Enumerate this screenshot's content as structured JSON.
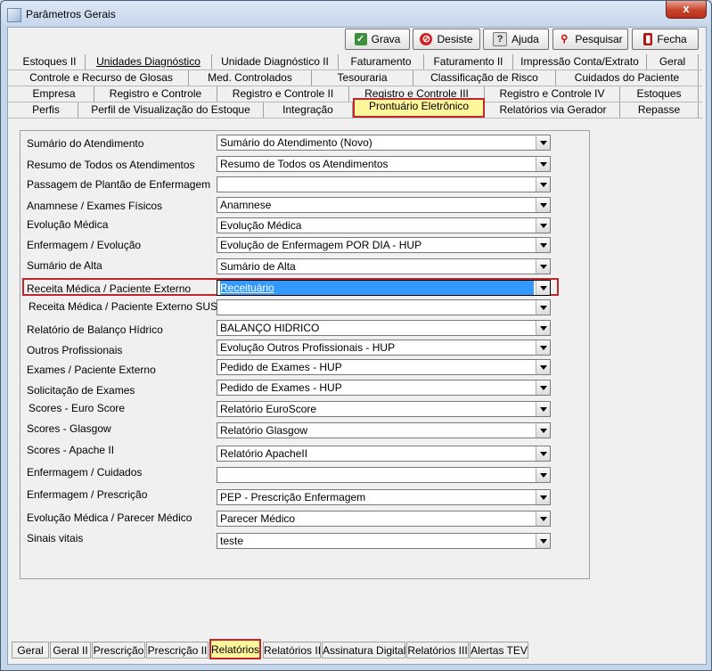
{
  "window": {
    "title": "Parâmetros Gerais",
    "close_glyph": "x"
  },
  "toolbar": {
    "grava": "Grava",
    "desiste": "Desiste",
    "ajuda": "Ajuda",
    "pesquisar": "Pesquisar",
    "fecha": "Fecha"
  },
  "top_tabs": {
    "row1": [
      "Estoques II",
      "Unidades Diagnóstico",
      "Unidade Diagnóstico II",
      "Faturamento",
      "Faturamento II",
      "Impressão Conta/Extrato",
      "Geral"
    ],
    "row2": [
      "Controle e Recurso de Glosas",
      "Med. Controlados",
      "Tesouraria",
      "Classificação de Risco",
      "Cuidados do Paciente"
    ],
    "row3": [
      "Empresa",
      "Registro e Controle",
      "Registro e Controle II",
      "Registro e Controle III",
      "Registro e Controle IV",
      "Estoques"
    ],
    "row4": [
      "Perfis",
      "Perfil de Visualização do Estoque",
      "Integração",
      "Prontuário Eletrônico",
      "Relatórios via Gerador",
      "Repasse"
    ],
    "selected": "Prontuário Eletrônico"
  },
  "fields": [
    {
      "label": "Sumário do Atendimento",
      "value": "Sumário do Atendimento (Novo)"
    },
    {
      "label": "Resumo de Todos os Atendimentos",
      "value": "Resumo de Todos os Atendimentos"
    },
    {
      "label": "Passagem de Plantão de Enfermagem",
      "value": ""
    },
    {
      "label": "Anamnese / Exames Físicos",
      "value": "Anamnese"
    },
    {
      "label": "Evolução Médica",
      "value": "Evolução Médica"
    },
    {
      "label": "Enfermagem / Evolução",
      "value": "Evolução de Enfermagem POR DIA - HUP"
    },
    {
      "label": "Sumário de Alta",
      "value": "Sumário de Alta"
    },
    {
      "label": "Receita Médica / Paciente Externo",
      "value": "Receituário"
    },
    {
      "label": "Receita Médica / Paciente Externo SUS",
      "value": ""
    },
    {
      "label": "Relatório de Balanço Hídrico",
      "value": "BALANÇO HIDRICO"
    },
    {
      "label": "Outros Profissionais",
      "value": "Evolução Outros Profissionais - HUP"
    },
    {
      "label": "Exames / Paciente Externo",
      "value": "Pedido de Exames - HUP"
    },
    {
      "label": "Solicitação de Exames",
      "value": "Pedido de Exames - HUP"
    },
    {
      "label": "Scores - Euro Score",
      "value": "Relatório EuroScore"
    },
    {
      "label": "Scores - Glasgow",
      "value": "Relatório Glasgow"
    },
    {
      "label": "Scores - Apache II",
      "value": "Relatório ApacheII"
    },
    {
      "label": "Enfermagem / Cuidados",
      "value": ""
    },
    {
      "label": "Enfermagem / Prescrição",
      "value": "PEP - Prescrição Enfermagem"
    },
    {
      "label": "Evolução Médica / Parecer Médico",
      "value": "Parecer Médico"
    },
    {
      "label": "Sinais vitais",
      "value": "teste"
    }
  ],
  "bottom_tabs": [
    "Geral",
    "Geral II",
    "Prescrição",
    "Prescrição II",
    "Relatórios",
    "Relatórios II",
    "Assinatura Digital",
    "Relatórios III",
    "Alertas TEV"
  ],
  "bottom_selected": "Relatórios",
  "colors": {
    "highlight_border": "#c0272d",
    "selected_tab_bg": "#fdf69a",
    "selection_blue": "#3399ff"
  }
}
